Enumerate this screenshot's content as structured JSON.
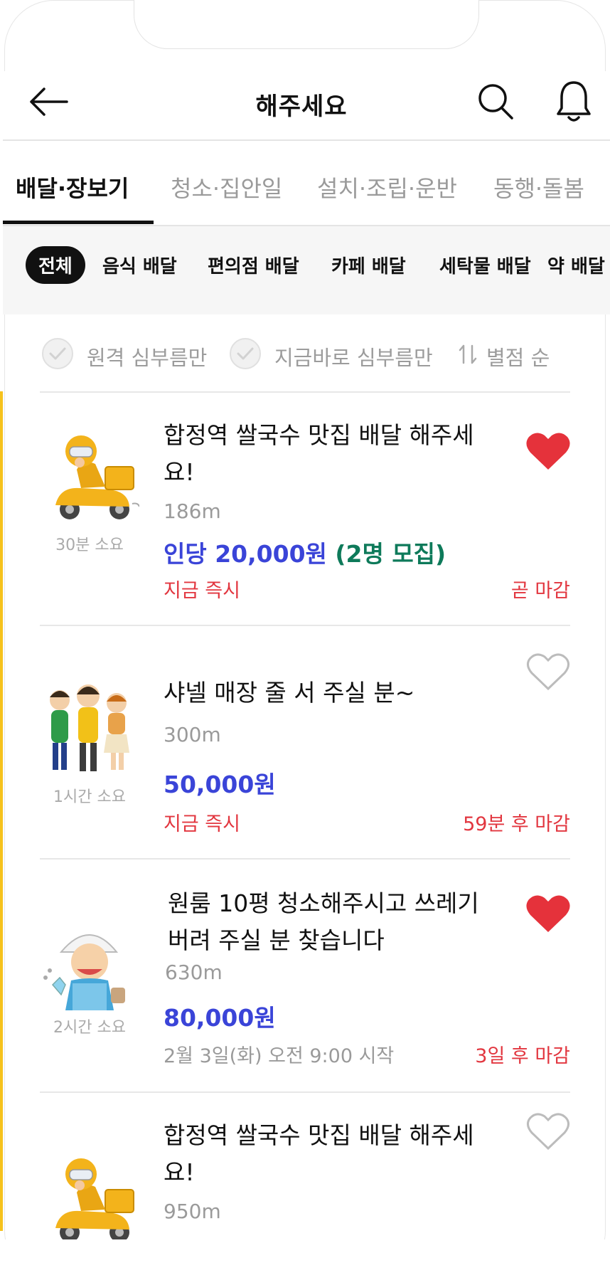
{
  "app_bar": {
    "title": "해주세요"
  },
  "main_tabs": [
    {
      "label": "배달·장보기",
      "active": true
    },
    {
      "label": "청소·집안일",
      "active": false
    },
    {
      "label": "설치·조립·운반",
      "active": false
    },
    {
      "label": "동행·돌봄",
      "active": false
    }
  ],
  "chips": [
    {
      "label": "전체",
      "active": true
    },
    {
      "label": "음식 배달"
    },
    {
      "label": "편의점 배달"
    },
    {
      "label": "카페 배달"
    },
    {
      "label": "세탁물 배달"
    },
    {
      "label": "약 배달"
    }
  ],
  "filters": {
    "remote_only": "원격 심부름만",
    "now_only": "지금바로 심부름만",
    "sort": "별점 순"
  },
  "listings": [
    {
      "title": "합정역 쌀국수 맛집 배달 해주세요!",
      "distance": "186m",
      "price": "인당 20,000원",
      "recruit": "(2명 모집)",
      "timing": "지금 즉시",
      "deadline": "곧 마감",
      "duration": "30분 소요",
      "favorited": true,
      "thumbnail_icon": "scooter-rider-icon"
    },
    {
      "title": "샤넬 매장 줄 서 주실 분~",
      "distance": "300m",
      "price": "50,000원",
      "timing": "지금 즉시",
      "deadline": "59분 후 마감",
      "duration": "1시간 소요",
      "favorited": false,
      "thumbnail_icon": "people-queue-icon"
    },
    {
      "title": "원룸 10평 청소해주시고 쓰레기 버려 주실 분 찾습니다",
      "distance": "630m",
      "price": "80,000원",
      "timing": "2월 3일(화) 오전 9:00 시작",
      "deadline": "3일 후 마감",
      "duration": "2시간 소요",
      "favorited": true,
      "thumbnail_icon": "cleaner-icon"
    },
    {
      "title": "합정역 쌀국수 맛집 배달 해주세요!",
      "distance": "950m",
      "favorited": false,
      "thumbnail_icon": "scooter-rider-icon"
    }
  ],
  "colors": {
    "price_blue": "#3a44d8",
    "recruit_green": "#0e7a5a",
    "deadline_red": "#e2363f",
    "heart_red": "#e5323b",
    "accent_yellow": "#f6c21c"
  }
}
